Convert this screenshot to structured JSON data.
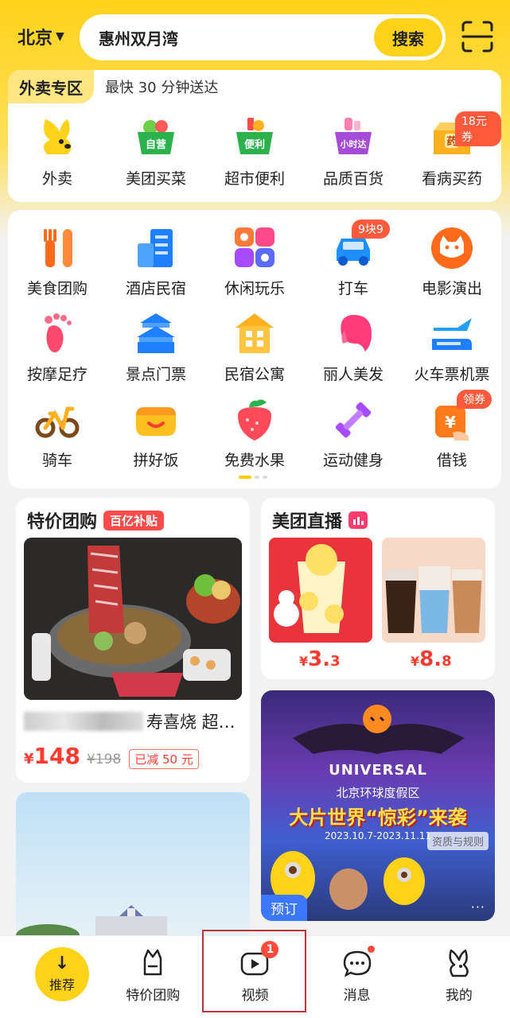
{
  "header": {
    "city": "北京",
    "search_query": "惠州双月湾",
    "search_button": "搜索"
  },
  "takeout": {
    "tag": "外卖专区",
    "subtitle": "最快 30 分钟送达",
    "items": [
      {
        "label": "外卖",
        "icon": "takeout-rabbit-icon"
      },
      {
        "label": "美团买菜",
        "icon": "grocery-basket-icon",
        "icon_text": "自营"
      },
      {
        "label": "超市便利",
        "icon": "supermarket-basket-icon",
        "icon_text": "便利"
      },
      {
        "label": "品质百货",
        "icon": "department-store-icon",
        "icon_text": "小时达"
      },
      {
        "label": "看病买药",
        "icon": "medicine-box-icon",
        "icon_text": "药",
        "badge": "18元券"
      }
    ]
  },
  "services": {
    "rows": [
      [
        {
          "label": "美食团购",
          "icon": "fork-knife-icon"
        },
        {
          "label": "酒店民宿",
          "icon": "hotel-building-icon"
        },
        {
          "label": "休闲玩乐",
          "icon": "leisure-grid-icon"
        },
        {
          "label": "打车",
          "icon": "taxi-car-icon",
          "badge": "9块9"
        },
        {
          "label": "电影演出",
          "icon": "movie-cat-icon"
        }
      ],
      [
        {
          "label": "按摩足疗",
          "icon": "footprint-icon"
        },
        {
          "label": "景点门票",
          "icon": "temple-icon"
        },
        {
          "label": "民宿公寓",
          "icon": "apartment-house-icon"
        },
        {
          "label": "丽人美发",
          "icon": "hair-salon-icon"
        },
        {
          "label": "火车票机票",
          "icon": "train-plane-icon"
        }
      ],
      [
        {
          "label": "骑车",
          "icon": "bicycle-icon"
        },
        {
          "label": "拼好饭",
          "icon": "group-meal-icon"
        },
        {
          "label": "免费水果",
          "icon": "strawberry-icon"
        },
        {
          "label": "运动健身",
          "icon": "dumbbell-icon"
        },
        {
          "label": "借钱",
          "icon": "loan-yen-icon",
          "badge": "领券"
        }
      ]
    ]
  },
  "deal_card": {
    "title": "特价团购",
    "pill": "百亿补贴",
    "name_visible": "寿喜烧 超…",
    "currency": "¥",
    "price": "148",
    "old_price": "¥198",
    "discount": "已减 50 元"
  },
  "live_card": {
    "title": "美团直播",
    "items": [
      {
        "currency": "¥",
        "price": "3.",
        "price_decimal": "3"
      },
      {
        "currency": "¥",
        "price": "8.",
        "price_decimal": "8"
      }
    ]
  },
  "universal_card": {
    "logo": "UNIVERSAL",
    "subtitle": "北京环球度假区",
    "slogan": "大片世界“惊彩”来袭",
    "date": "2023.10.7-2023.11.11",
    "qualification": "资质与规则",
    "tag": "预订",
    "more": "···"
  },
  "tabbar": {
    "tabs": [
      {
        "label": "推荐",
        "icon": "recommend-arrow-icon"
      },
      {
        "label": "特价团购",
        "icon": "deal-bag-icon"
      },
      {
        "label": "视频",
        "icon": "video-play-icon",
        "badge": "1"
      },
      {
        "label": "消息",
        "icon": "message-bubble-icon"
      },
      {
        "label": "我的",
        "icon": "profile-rabbit-icon"
      }
    ]
  },
  "colors": {
    "brand_yellow": "#ffd21a",
    "price_red": "#ff3b30",
    "badge_red": "#ff4a3a"
  }
}
